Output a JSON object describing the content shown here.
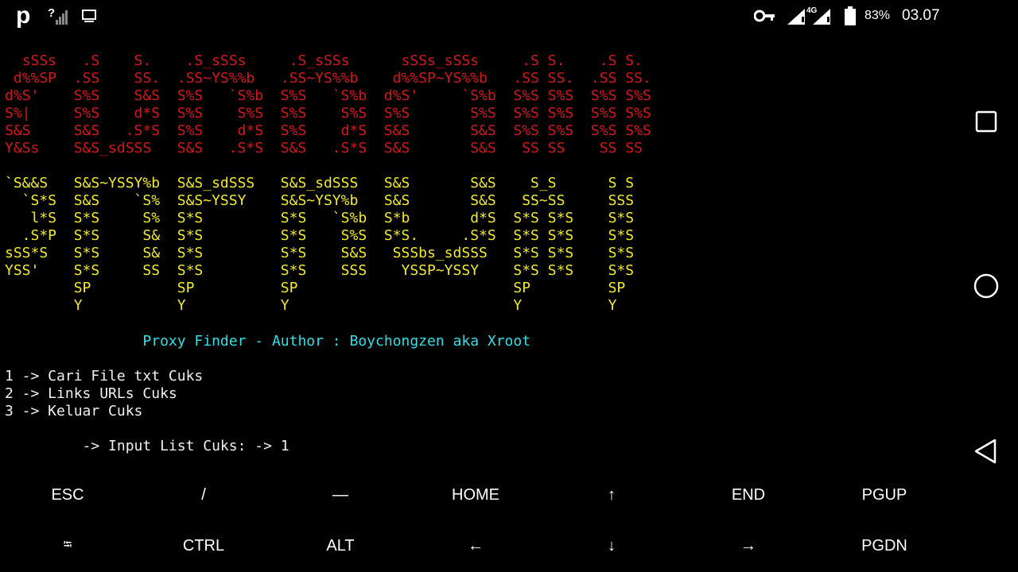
{
  "status_bar": {
    "app_icon": "p",
    "notification_icons": [
      "no-signal-question-icon",
      "screen-icon"
    ],
    "system_icons": [
      "vpn-key-icon",
      "signal-4g-icon",
      "battery-icon"
    ],
    "battery_percent": "83%",
    "time": "03.07",
    "network_type": "4G"
  },
  "terminal": {
    "colors": {
      "banner_top": "#d3171b",
      "banner_bottom": "#f2ea2b",
      "subtitle": "#2ee0e8",
      "text": "#f0f0f0"
    },
    "banner_red": [
      "  sSSs   .S    S.    .S_sSSs     .S_sSSs      sSSs_sSSs     .S S.    .S S.",
      " d%%SP  .SS    SS.  .SS~YS%%b   .SS~YS%%b    d%%SP~YS%%b   .SS SS.  .SS SS.",
      "d%S'    S%S    S&S  S%S   `S%b  S%S   `S%b  d%S'     `S%b  S%S S%S  S%S S%S",
      "S%|     S%S    d*S  S%S    S%S  S%S    S%S  S%S       S%S  S%S S%S  S%S S%S",
      "S&S     S&S   .S*S  S%S    d*S  S%S    d*S  S&S       S&S  S%S S%S  S%S S%S",
      "Y&Ss    S&S_sdSSS   S&S   .S*S  S&S   .S*S  S&S       S&S   SS SS    SS SS"
    ],
    "banner_yellow": [
      "`S&&S   S&S~YSSY%b  S&S_sdSSS   S&S_sdSSS   S&S       S&S    S_S      S S",
      "  `S*S  S&S    `S%  S&S~YSSY    S&S~YSY%b   S&S       S&S   SS~SS     SSS",
      "   l*S  S*S     S%  S*S         S*S   `S%b  S*b       d*S  S*S S*S    S*S",
      "  .S*P  S*S     S&  S*S         S*S    S%S  S*S.     .S*S  S*S S*S    S*S",
      "sSS*S   S*S     S&  S*S         S*S    S&S   SSSbs_sdSSS   S*S S*S    S*S",
      "YSS'    S*S     SS  S*S         S*S    SSS    YSSP~YSSY    S*S S*S    S*S",
      "        SP          SP          SP                         SP         SP",
      "        Y           Y           Y                          Y          Y"
    ],
    "subtitle": "                Proxy Finder - Author : Boychongzen aka Xroot",
    "menu": [
      "1 -> Cari File txt Cuks",
      "2 -> Links URLs Cuks",
      "3 -> Keluar Cuks"
    ],
    "prompt": "         -> Input List Cuks: -> 1"
  },
  "nav_bar": {
    "buttons": [
      "recent-apps-icon",
      "home-icon",
      "back-icon"
    ]
  },
  "extra_keys": {
    "row1": [
      "ESC",
      "/",
      "—",
      "HOME",
      "↑",
      "END",
      "PGUP"
    ],
    "row2": [
      "⭾",
      "CTRL",
      "ALT",
      "←",
      "↓",
      "→",
      "PGDN"
    ]
  }
}
